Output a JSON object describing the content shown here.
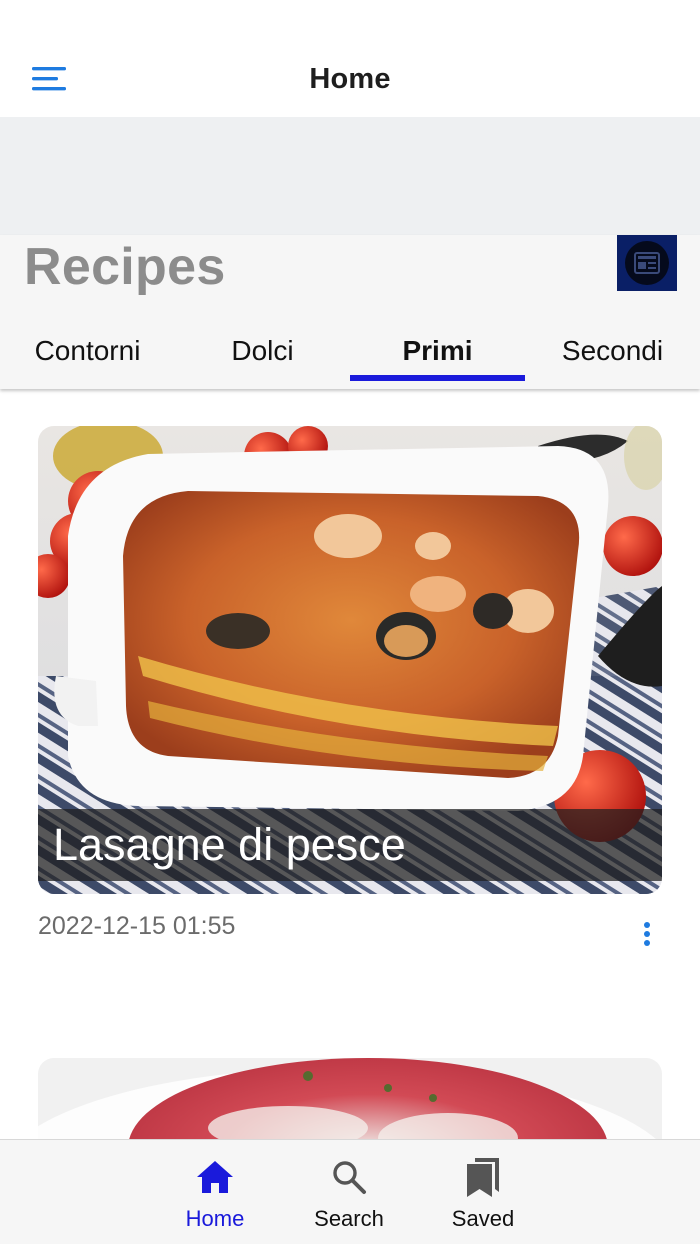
{
  "header": {
    "title": "Home",
    "menu_icon": "menu-icon"
  },
  "section": {
    "title": "Recipes",
    "news_icon": "newspaper-icon"
  },
  "tabs": [
    {
      "label": "Contorni",
      "active": false
    },
    {
      "label": "Dolci",
      "active": false
    },
    {
      "label": "Primi",
      "active": true
    },
    {
      "label": "Secondi",
      "active": false
    }
  ],
  "recipes": [
    {
      "title": "Lasagne di pesce",
      "date": "2022-12-15 01:55",
      "more_icon": "more-vertical-icon"
    }
  ],
  "bottom_nav": [
    {
      "label": "Home",
      "icon": "home-icon",
      "active": true
    },
    {
      "label": "Search",
      "icon": "search-icon",
      "active": false
    },
    {
      "label": "Saved",
      "icon": "bookmark-icon",
      "active": false
    }
  ],
  "colors": {
    "accent": "#1a1adb",
    "menu_blue": "#1e7be0",
    "news_button_bg": "#0a1f66",
    "section_bg": "#f6f6f6",
    "ad_band_bg": "#eef0f2"
  }
}
